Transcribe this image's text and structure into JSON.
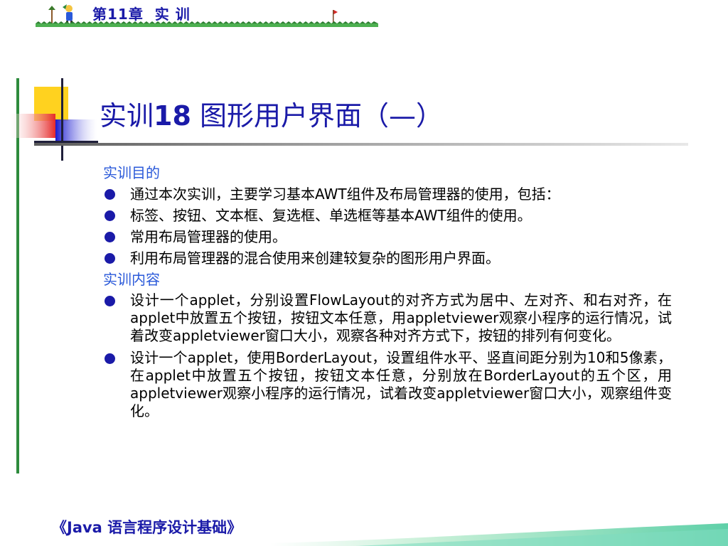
{
  "header": {
    "chapter": "第11章  实 训"
  },
  "title": {
    "prefix": "实训",
    "number": "18",
    "suffix": "  图形用户界面（—）"
  },
  "sections": [
    {
      "heading": "实训目的",
      "items": [
        "通过本次实训，主要学习基本AWT组件及布局管理器的使用，包括：",
        "标签、按钮、文本框、复选框、单选框等基本AWT组件的使用。",
        "常用布局管理器的使用。",
        "利用布局管理器的混合使用来创建较复杂的图形用户界面。"
      ]
    },
    {
      "heading": "实训内容",
      "items": [
        "设计一个applet，分别设置FlowLayout的对齐方式为居中、左对齐、和右对齐，在applet中放置五个按钮，按钮文本任意，用appletviewer观察小程序的运行情况，试着改变appletviewer窗口大小，观察各种对齐方式下，按钮的排列有何变化。",
        "设计一个applet，使用BorderLayout，设置组件水平、竖直间距分别为10和5像素，在applet中放置五个按钮，按钮文本任意，分别放在BorderLayout的五个区，用appletviewer观察小程序的运行情况，试着改变appletviewer窗口大小，观察组件变化。"
      ]
    }
  ],
  "footer": {
    "book_title": "《Java 语言程序设计基础》"
  },
  "colors": {
    "title": "#1a1aa8",
    "section_heading": "#2a59d9",
    "bullet": "#1a1aa8",
    "vertical_bar": "#2e8b3d"
  }
}
